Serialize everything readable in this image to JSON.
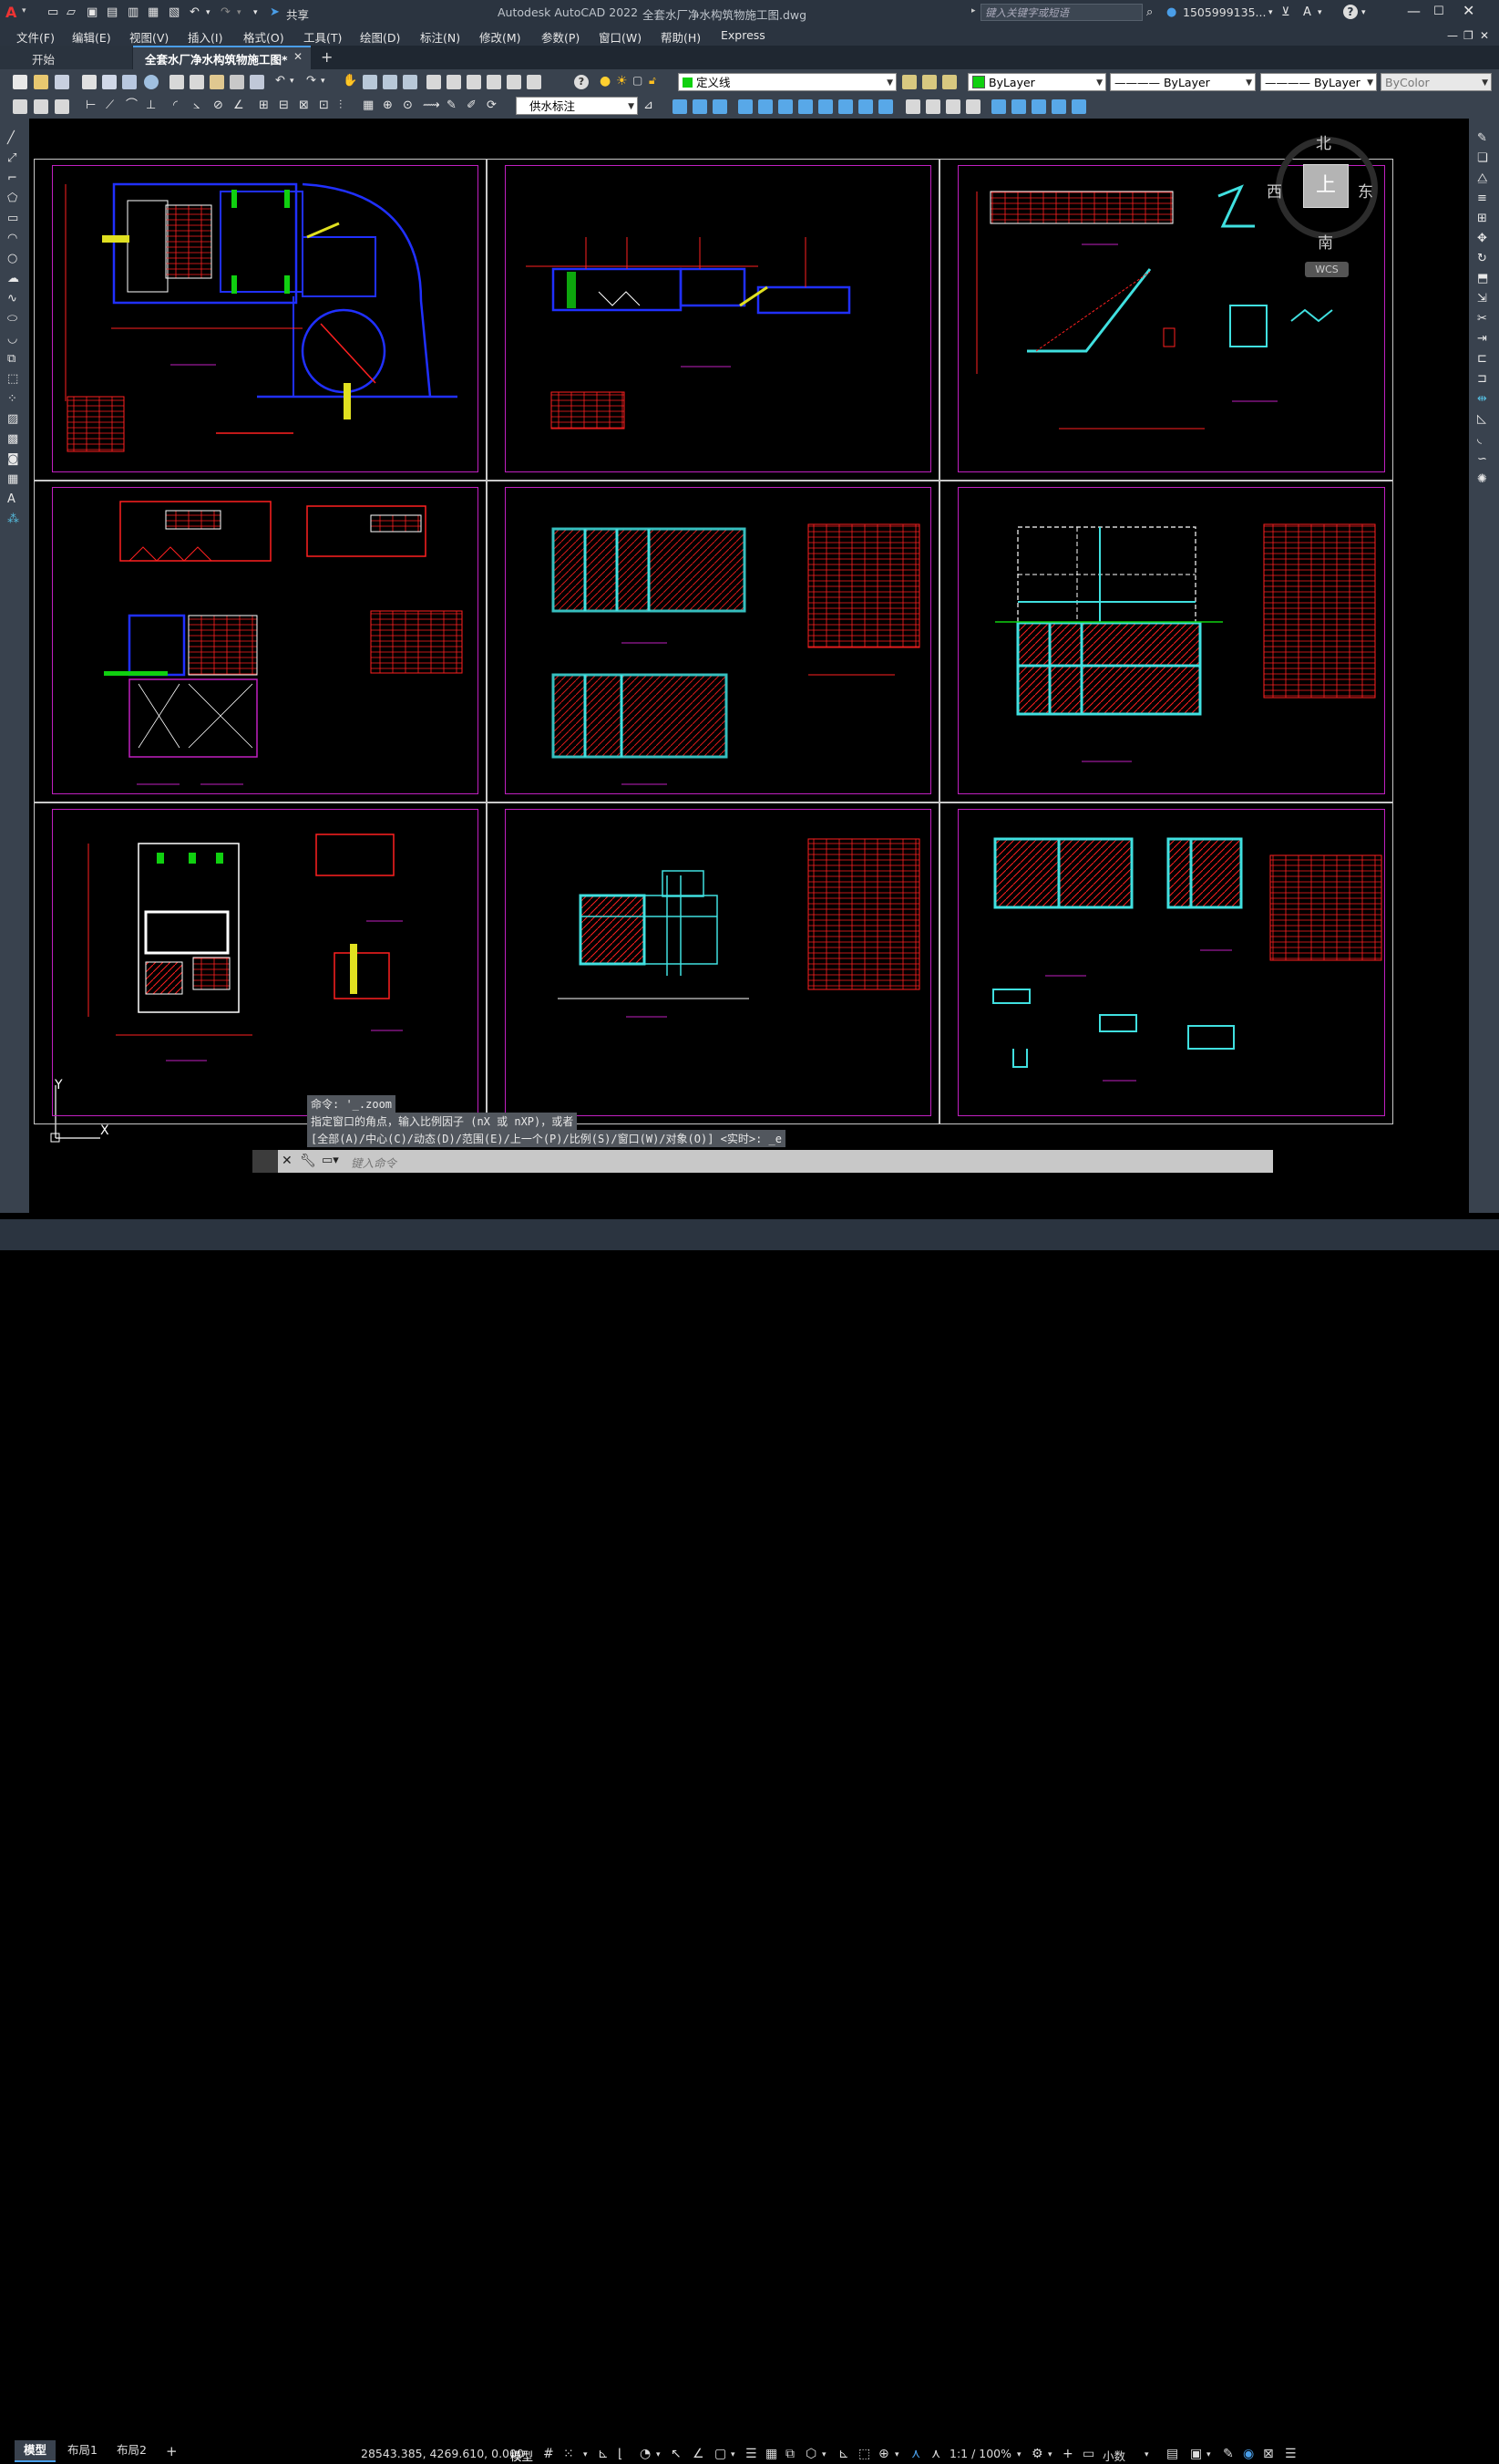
{
  "app": {
    "title": "Autodesk AutoCAD 2022",
    "filename": "全套水厂净水构筑物施工图.dwg",
    "share_label": "共享",
    "search_placeholder": "键入关键字或短语",
    "user": "1505999135...",
    "help": "?"
  },
  "menus": [
    "文件(F)",
    "编辑(E)",
    "视图(V)",
    "插入(I)",
    "格式(O)",
    "工具(T)",
    "绘图(D)",
    "标注(N)",
    "修改(M)",
    "参数(P)",
    "窗口(W)",
    "帮助(H)",
    "Express"
  ],
  "tabs": {
    "start": "开始",
    "active": "全套水厂净水构筑物施工图*",
    "add": "+"
  },
  "toolbar": {
    "layer_name": "定义线",
    "color": "ByLayer",
    "linetype": "———— ByLayer",
    "lineweight": "———— ByLayer",
    "plotstyle": "ByColor",
    "dim_style": "供水标注"
  },
  "viewcube": {
    "north": "北",
    "south": "南",
    "east": "东",
    "west": "西",
    "face": "上",
    "wcs": "WCS"
  },
  "ucs": {
    "x": "X",
    "y": "Y"
  },
  "command": {
    "history1": "命令: '_.zoom",
    "history2": "指定窗口的角点，输入比例因子 (nX 或 nXP)，或者",
    "history3": "[全部(A)/中心(C)/动态(D)/范围(E)/上一个(P)/比例(S)/窗口(W)/对象(O)] <实时>: _e",
    "placeholder": "键入命令"
  },
  "layout_tabs": [
    "模型",
    "布局1",
    "布局2"
  ],
  "status": {
    "coords": "28543.385, 4269.610, 0.000",
    "model": "模型",
    "scale": "1:1 / 100%",
    "units": "小数"
  },
  "colors": {
    "accent_red": "#ff2020",
    "frame_magenta": "#c020c0",
    "cyan": "#40e0e0",
    "blue": "#2030ff",
    "yellow": "#e0e020"
  }
}
